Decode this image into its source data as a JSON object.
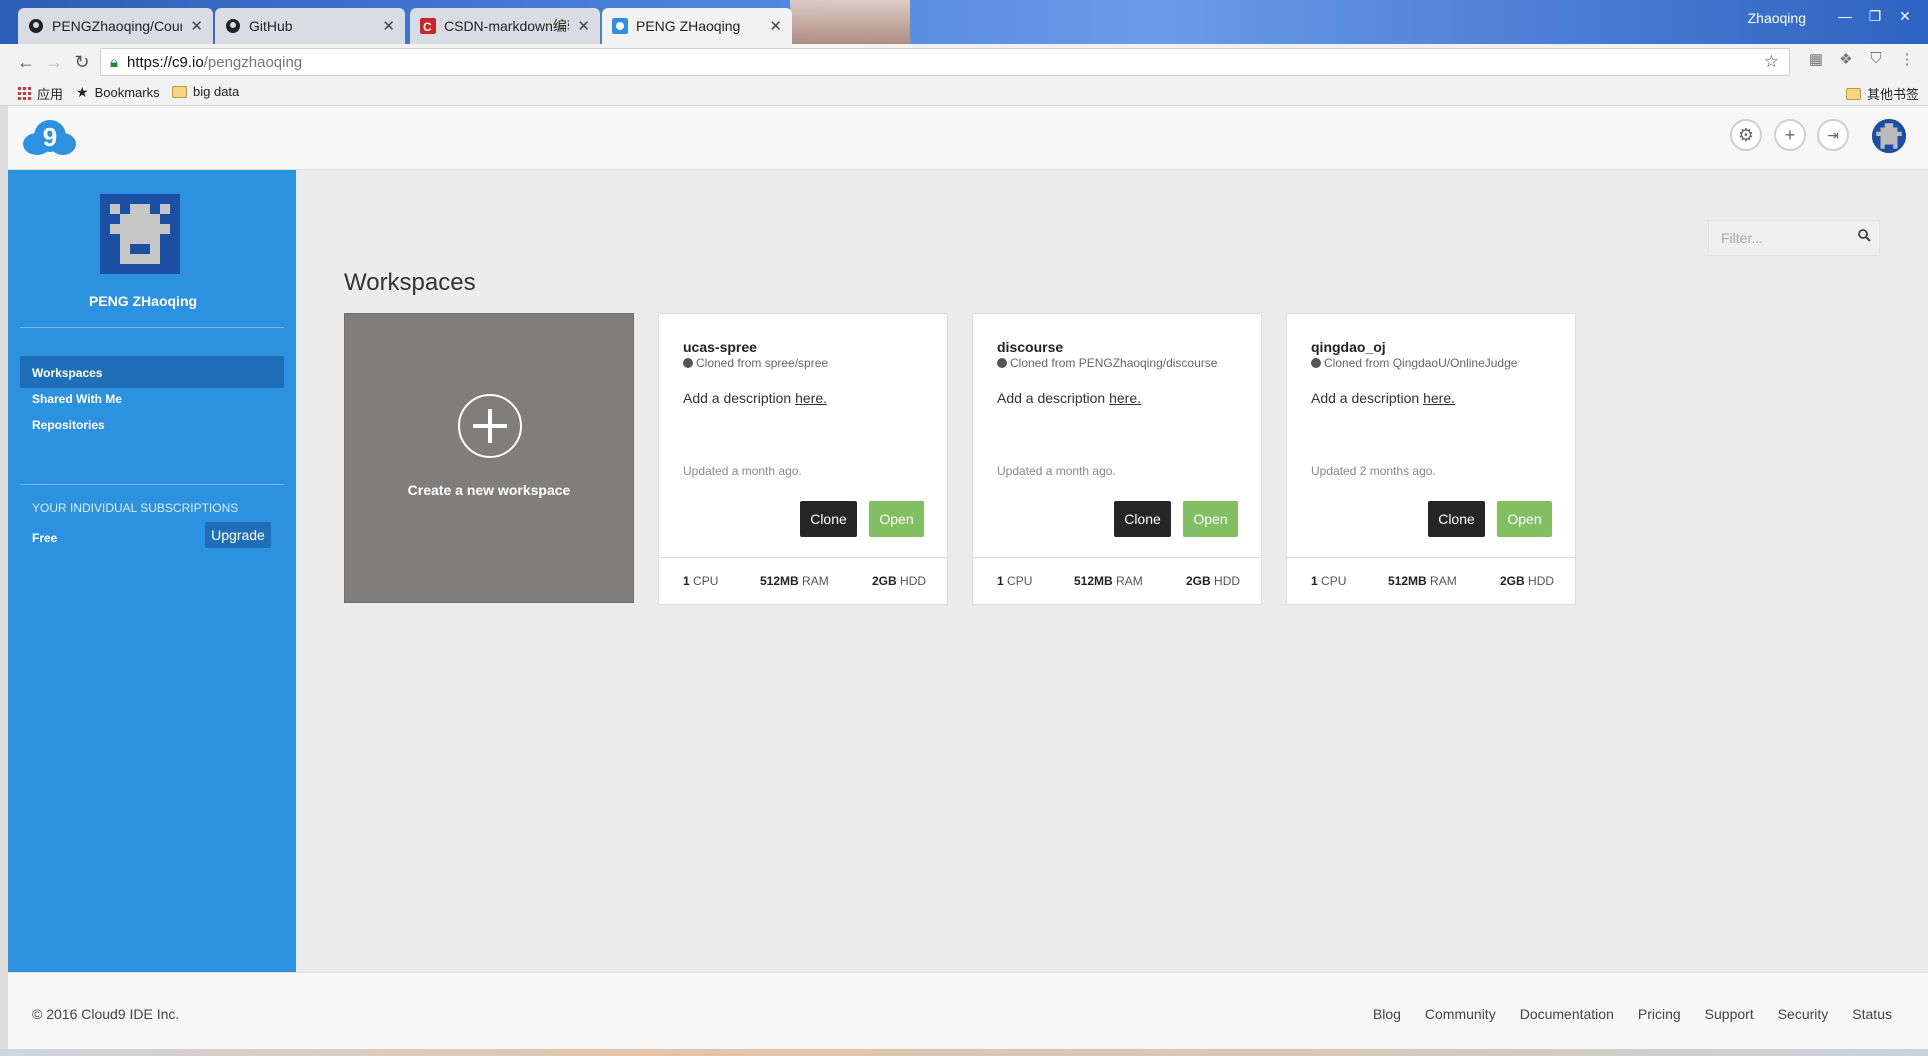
{
  "browser": {
    "tabs": [
      {
        "title": "PENGZhaoqing/Course",
        "icon": "github-icon"
      },
      {
        "title": "GitHub",
        "icon": "github-icon"
      },
      {
        "title": "CSDN-markdown编辑",
        "icon": "csdn-icon"
      },
      {
        "title": "PENG ZHaoqing",
        "icon": "cloud9-icon",
        "active": true
      }
    ],
    "window_user": "Zhaoqing",
    "url_host": "https://c9.io",
    "url_path": "/pengzhaoqing",
    "bookmarks": [
      {
        "label": "应用",
        "icon": "apps-grid-icon"
      },
      {
        "label": "Bookmarks",
        "icon": "star-icon"
      },
      {
        "label": "big data",
        "icon": "folder-icon"
      }
    ],
    "other_bookmarks": "其他书签"
  },
  "header": {
    "logo_text": "9",
    "buttons": [
      "settings-icon",
      "plus-icon",
      "logout-icon"
    ],
    "accent_color": "#2c92e0"
  },
  "sidebar": {
    "user_name": "PENG ZHaoqing",
    "nav": [
      {
        "label": "Workspaces",
        "active": true
      },
      {
        "label": "Shared With Me"
      },
      {
        "label": "Repositories"
      }
    ],
    "subscriptions_title": "YOUR INDIVIDUAL SUBSCRIPTIONS",
    "plan": "Free",
    "upgrade_label": "Upgrade"
  },
  "main": {
    "filter_placeholder": "Filter...",
    "title": "Workspaces",
    "create_label": "Create a new workspace",
    "workspaces": [
      {
        "name": "ucas-spree",
        "source": "Cloned from spree/spree",
        "desc_prefix": "Add a description",
        "desc_link": "here.",
        "updated": "Updated a month ago.",
        "clone_label": "Clone",
        "open_label": "Open",
        "cpu_value": "1",
        "cpu_unit": "CPU",
        "ram_value": "512MB",
        "ram_unit": "RAM",
        "hdd_value": "2GB",
        "hdd_unit": "HDD"
      },
      {
        "name": "discourse",
        "source": "Cloned from PENGZhaoqing/discourse",
        "desc_prefix": "Add a description",
        "desc_link": "here.",
        "updated": "Updated a month ago.",
        "clone_label": "Clone",
        "open_label": "Open",
        "cpu_value": "1",
        "cpu_unit": "CPU",
        "ram_value": "512MB",
        "ram_unit": "RAM",
        "hdd_value": "2GB",
        "hdd_unit": "HDD"
      },
      {
        "name": "qingdao_oj",
        "source": "Cloned from QingdaoU/OnlineJudge",
        "desc_prefix": "Add a description",
        "desc_link": "here.",
        "updated": "Updated 2 months ago.",
        "clone_label": "Clone",
        "open_label": "Open",
        "cpu_value": "1",
        "cpu_unit": "CPU",
        "ram_value": "512MB",
        "ram_unit": "RAM",
        "hdd_value": "2GB",
        "hdd_unit": "HDD"
      }
    ]
  },
  "footer": {
    "copyright": "© 2016 Cloud9 IDE Inc.",
    "links": [
      "Blog",
      "Community",
      "Documentation",
      "Pricing",
      "Support",
      "Security",
      "Status"
    ]
  }
}
